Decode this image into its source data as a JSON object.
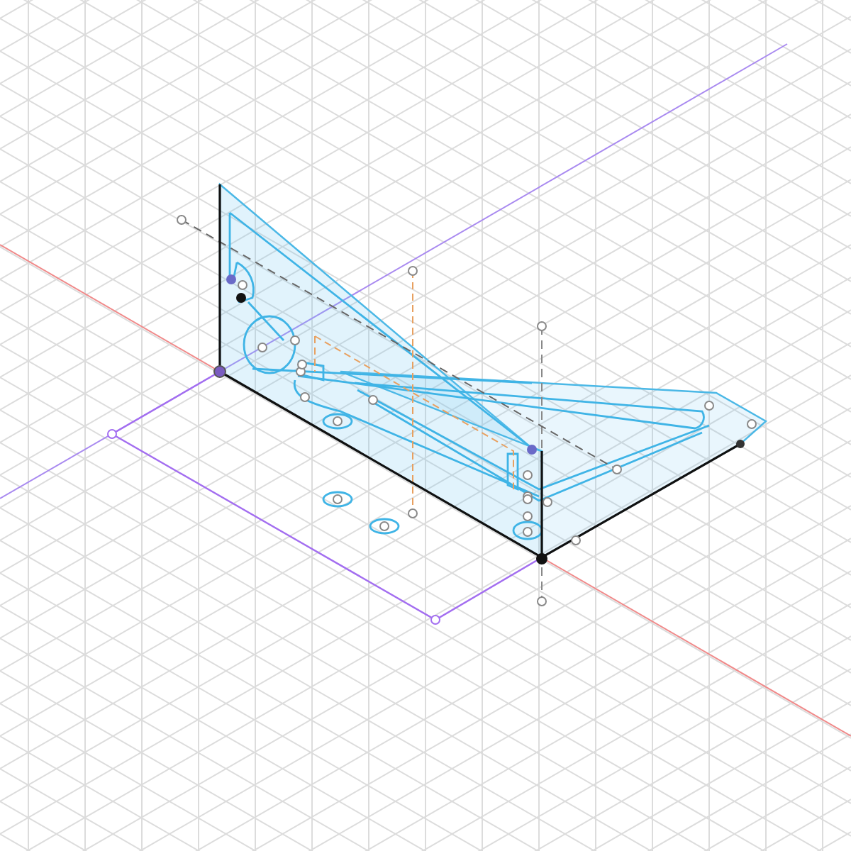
{
  "view": {
    "kind": "isometric"
  }
}
